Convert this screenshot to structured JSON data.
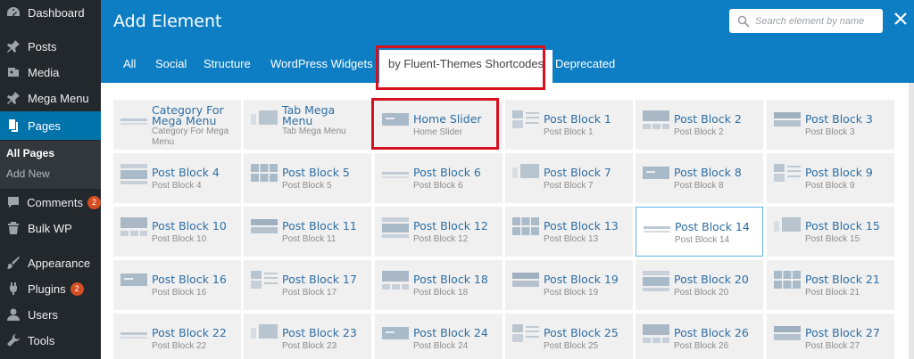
{
  "sidebar": {
    "items": [
      {
        "label": "Dashboard",
        "icon": "dashboard-icon"
      },
      {
        "label": "Posts",
        "icon": "pin-icon"
      },
      {
        "label": "Media",
        "icon": "media-icon"
      },
      {
        "label": "Mega Menu",
        "icon": "pin-icon"
      },
      {
        "label": "Pages",
        "icon": "pages-icon"
      },
      {
        "label": "Comments",
        "icon": "comment-icon",
        "badge": "2"
      },
      {
        "label": "Bulk WP",
        "icon": "trash-icon"
      },
      {
        "label": "Appearance",
        "icon": "brush-icon"
      },
      {
        "label": "Plugins",
        "icon": "plug-icon",
        "badge": "2"
      },
      {
        "label": "Users",
        "icon": "user-icon"
      },
      {
        "label": "Tools",
        "icon": "wrench-icon"
      }
    ],
    "submenu": [
      {
        "label": "All Pages"
      },
      {
        "label": "Add New"
      }
    ],
    "colors": {
      "bg": "#23282d",
      "active": "#0073aa",
      "badge": "#d54e21"
    }
  },
  "modal": {
    "title": "Add Element",
    "search": {
      "placeholder": "Search element by name"
    },
    "tabs": [
      {
        "label": "All"
      },
      {
        "label": "Social"
      },
      {
        "label": "Structure"
      },
      {
        "label": "WordPress Widgets"
      },
      {
        "label": "by Fluent-Themes Shortcodes",
        "active": true
      },
      {
        "label": "Deprecated"
      }
    ],
    "colors": {
      "header": "#0e7ec4",
      "highlight": "#d4111d",
      "link": "#2e6ea3"
    }
  },
  "elements": [
    {
      "name": "Category For Mega Menu",
      "desc": "Category For Mega Menu"
    },
    {
      "name": "Tab Mega Menu",
      "desc": "Tab Mega Menu"
    },
    {
      "name": "Home Slider",
      "desc": "Home Slider"
    },
    {
      "name": "Post Block 1",
      "desc": "Post Block 1"
    },
    {
      "name": "Post Block 2",
      "desc": "Post Block 2"
    },
    {
      "name": "Post Block 3",
      "desc": "Post Block 3"
    },
    {
      "name": "Post Block 4",
      "desc": "Post Block 4"
    },
    {
      "name": "Post Block 5",
      "desc": "Post Block 5"
    },
    {
      "name": "Post Block 6",
      "desc": "Post Block 6"
    },
    {
      "name": "Post Block 7",
      "desc": "Post Block 7"
    },
    {
      "name": "Post Block 8",
      "desc": "Post Block 8"
    },
    {
      "name": "Post Block 9",
      "desc": "Post Block 9"
    },
    {
      "name": "Post Block 10",
      "desc": "Post Block 10"
    },
    {
      "name": "Post Block 11",
      "desc": "Post Block 11"
    },
    {
      "name": "Post Block 12",
      "desc": "Post Block 12"
    },
    {
      "name": "Post Block 13",
      "desc": "Post Block 13"
    },
    {
      "name": "Post Block 14",
      "desc": "Post Block 14"
    },
    {
      "name": "Post Block 15",
      "desc": "Post Block 15"
    },
    {
      "name": "Post Block 16",
      "desc": "Post Block 16"
    },
    {
      "name": "Post Block 17",
      "desc": "Post Block 17"
    },
    {
      "name": "Post Block 18",
      "desc": "Post Block 18"
    },
    {
      "name": "Post Block 19",
      "desc": "Post Block 19"
    },
    {
      "name": "Post Block 20",
      "desc": "Post Block 20"
    },
    {
      "name": "Post Block 21",
      "desc": "Post Block 21"
    },
    {
      "name": "Post Block 22",
      "desc": "Post Block 22"
    },
    {
      "name": "Post Block 23",
      "desc": "Post Block 23"
    },
    {
      "name": "Post Block 24",
      "desc": "Post Block 24"
    },
    {
      "name": "Post Block 25",
      "desc": "Post Block 25"
    },
    {
      "name": "Post Block 26",
      "desc": "Post Block 26"
    },
    {
      "name": "Post Block 27",
      "desc": "Post Block 27"
    }
  ]
}
